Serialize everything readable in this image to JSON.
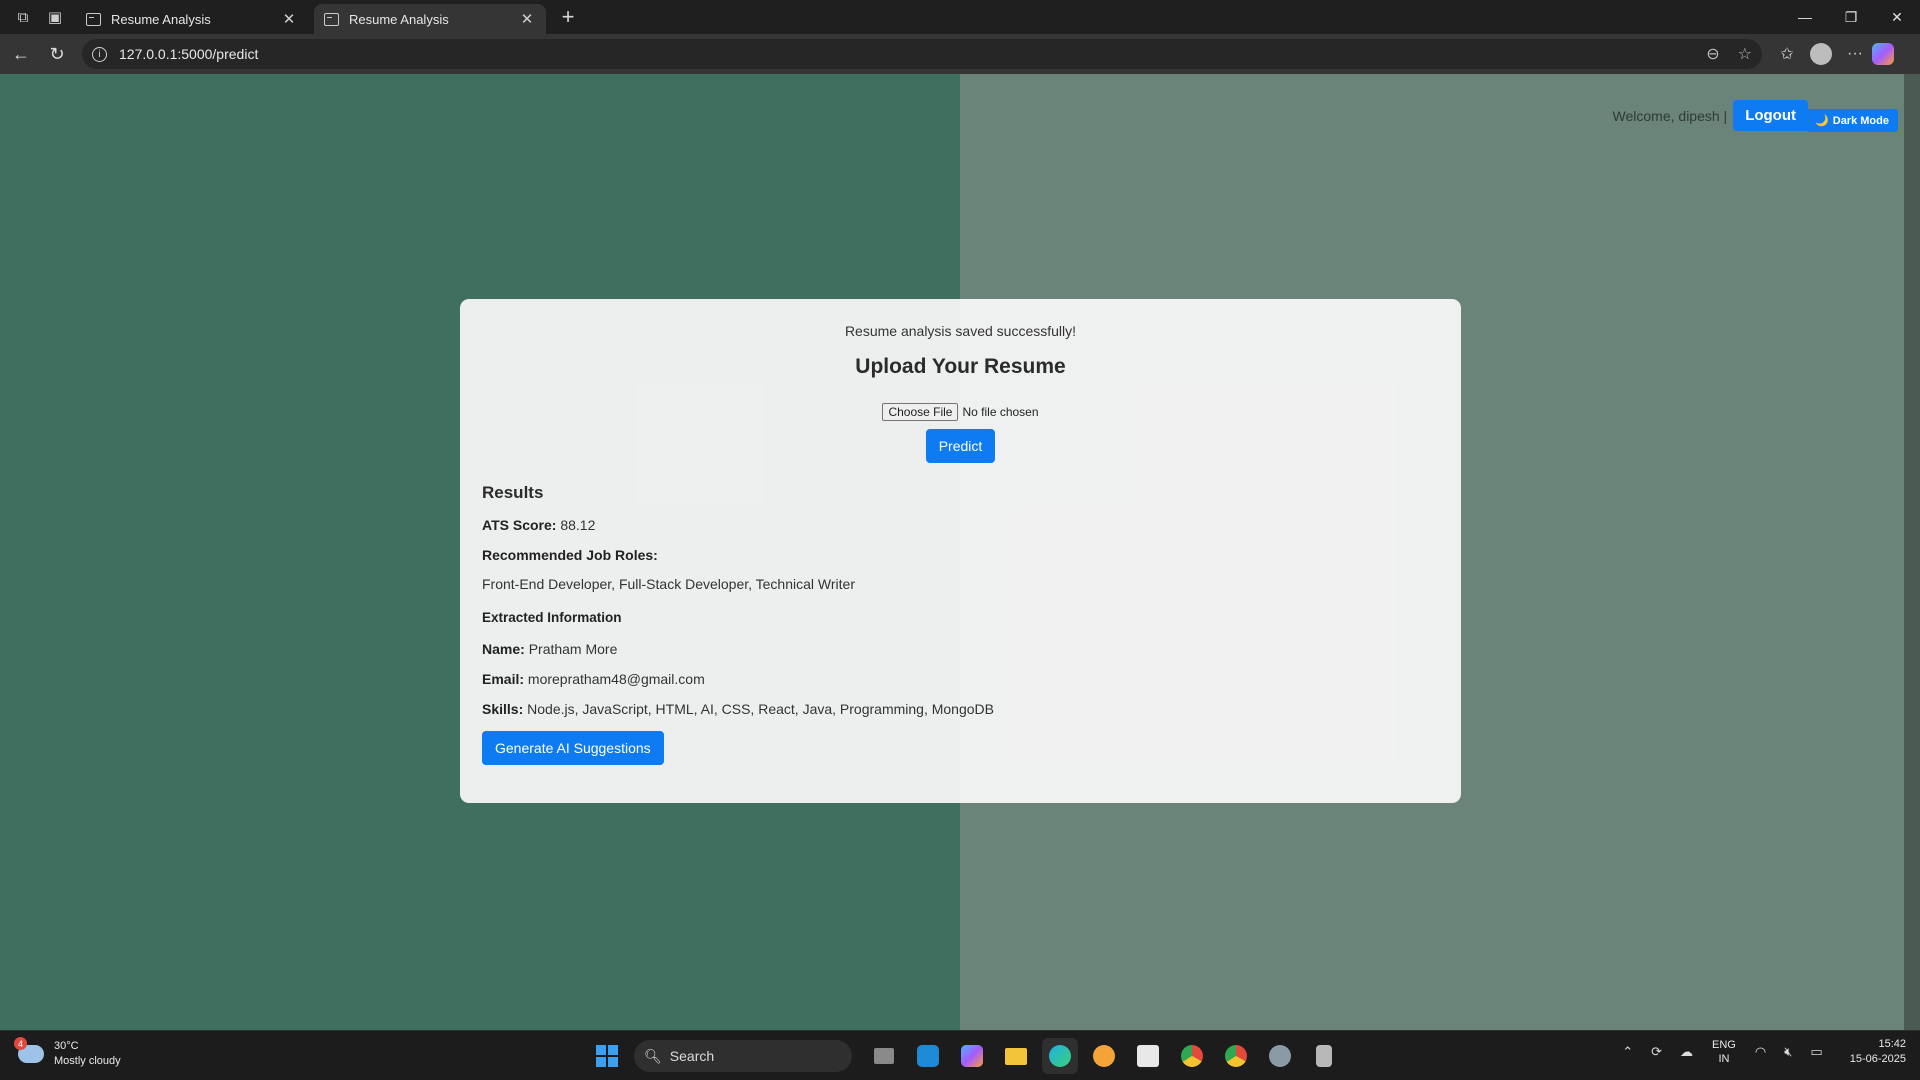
{
  "browser": {
    "tabs": [
      {
        "title": "Resume Analysis",
        "active": false
      },
      {
        "title": "Resume Analysis",
        "active": true
      }
    ],
    "new_tab_icon": "plus-icon",
    "url": "127.0.0.1:5000/predict",
    "window_controls": [
      "minimize-icon",
      "restore-icon",
      "close-icon"
    ]
  },
  "header": {
    "welcome": "Welcome, dipesh |",
    "logout_label": "Logout",
    "dark_mode_label": "Dark Mode",
    "dark_mode_icon": "moon-icon"
  },
  "card": {
    "message": "Resume analysis saved successfully!",
    "title": "Upload Your Resume",
    "choose_file_label": "Choose File",
    "no_file_text": "No file chosen",
    "predict_label": "Predict",
    "results_heading": "Results",
    "ats_label": "ATS Score:",
    "ats_value": "88.12",
    "roles_label": "Recommended Job Roles:",
    "roles_value": "Front-End Developer, Full-Stack Developer, Technical Writer",
    "extracted_heading": "Extracted Information",
    "name_label": "Name:",
    "name_value": "Pratham More",
    "email_label": "Email:",
    "email_value": "morepratham48@gmail.com",
    "skills_label": "Skills:",
    "skills_value": "Node.js, JavaScript, HTML, AI, CSS, React, Java, Programming, MongoDB",
    "generate_label": "Generate AI Suggestions"
  },
  "taskbar": {
    "weather_badge": "4",
    "temperature": "30°C",
    "condition": "Mostly cloudy",
    "search_label": "Search",
    "lang_top": "ENG",
    "lang_bottom": "IN",
    "time": "15:42",
    "date": "15-06-2025"
  },
  "colors": {
    "accent": "#0f7bf3",
    "bg_left": "#3f6f5e",
    "bg_right": "#6a8479"
  }
}
